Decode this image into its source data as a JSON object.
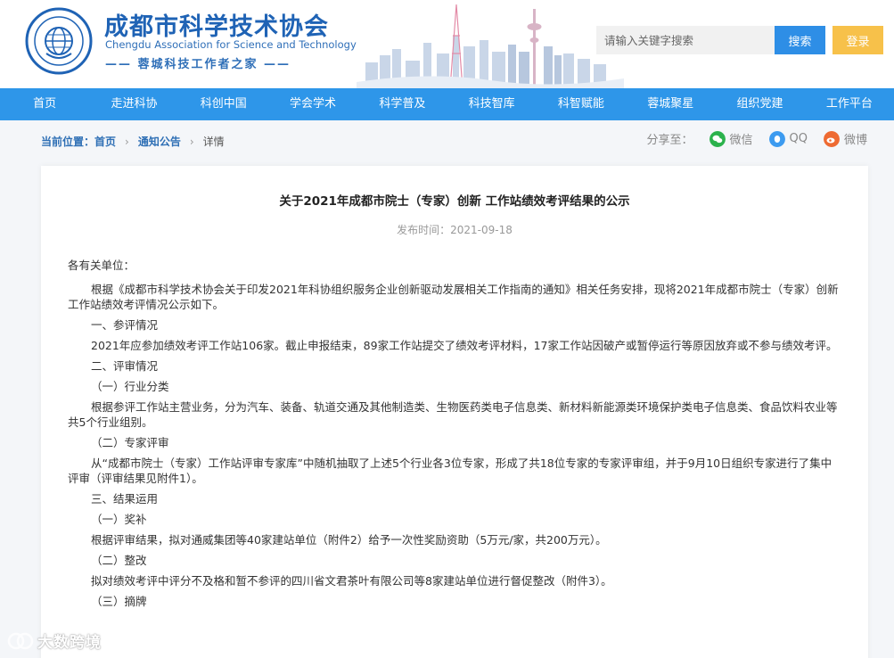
{
  "header": {
    "brand_cn": "成都市科学技术协会",
    "brand_en": "Chengdu Association for Science and Technology",
    "slogan": "—— 蓉城科技工作者之家 ——",
    "search_placeholder": "请输入关键字搜索",
    "search_label": "搜索",
    "login_label": "登录"
  },
  "nav": {
    "items": [
      "首页",
      "走进科协",
      "科创中国",
      "学会学术",
      "科学普及",
      "科技智库",
      "科智赋能",
      "蓉城聚星",
      "组织党建",
      "工作平台"
    ]
  },
  "breadcrumb": {
    "prefix": "当前位置：",
    "home": "首页",
    "section": "通知公告",
    "current": "详情"
  },
  "share": {
    "label": "分享至：",
    "wechat": "微信",
    "qq": "QQ",
    "weibo": "微博"
  },
  "article": {
    "title": "关于2021年成都市院士（专家）创新 工作站绩效考评结果的公示",
    "date": "发布时间：2021-09-18",
    "paragraphs": [
      "各有关单位：",
      "根据《成都市科学技术协会关于印发2021年科协组织服务企业创新驱动发展相关工作指南的通知》相关任务安排，现将2021年成都市院士（专家）创新工作站绩效考评情况公示如下。",
      "一、参评情况",
      "2021年应参加绩效考评工作站106家。截止申报结束，89家工作站提交了绩效考评材料，17家工作站因破产或暂停运行等原因放弃或不参与绩效考评。",
      "二、评审情况",
      "（一）行业分类",
      "根据参评工作站主营业务，分为汽车、装备、轨道交通及其他制造类、生物医药类电子信息类、新材料新能源类环境保护类电子信息类、食品饮料农业等共5个行业组别。",
      "（二）专家评审",
      "从“成都市院士（专家）工作站评审专家库”中随机抽取了上述5个行业各3位专家，形成了共18位专家的专家评审组，并于9月10日组织专家进行了集中评审（评审结果见附件1）。",
      "三、结果运用",
      "（一）奖补",
      "根据评审结果，拟对通威集团等40家建站单位（附件2）给予一次性奖励资助（5万元/家，共200万元）。",
      "（二）整改",
      "拟对绩效考评中评分不及格和暂不参评的四川省文君茶叶有限公司等8家建站单位进行督促整改（附件3）。",
      "（三）摘牌"
    ]
  },
  "watermark": "大数跨境"
}
